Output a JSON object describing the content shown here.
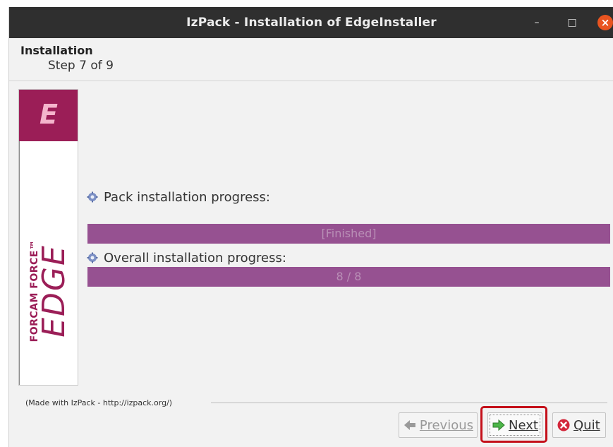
{
  "window": {
    "title": "IzPack - Installation of  EdgeInstaller",
    "controls": {
      "minimize": "–",
      "maximize": "□",
      "close": "×"
    }
  },
  "header": {
    "title": "Installation",
    "step": "Step 7 of 9"
  },
  "sidebar": {
    "logo_letter": "E",
    "brand_small": "FORCAM FORCE™",
    "brand_large": "EDGE"
  },
  "progress": {
    "pack": {
      "label": "Pack installation progress:",
      "text": "[Finished]",
      "fraction": 1.0
    },
    "overall": {
      "label": "Overall installation progress:",
      "text": "8 / 8",
      "fraction": 1.0
    }
  },
  "footer": {
    "made_with": "(Made with IzPack - http://izpack.org/)"
  },
  "buttons": {
    "previous": {
      "label": "Previous",
      "icon": "arrow-left-icon",
      "enabled": false
    },
    "next": {
      "label": "Next",
      "icon": "arrow-right-icon",
      "enabled": true
    },
    "quit": {
      "label": "Quit",
      "icon": "quit-icon",
      "enabled": true
    }
  },
  "colors": {
    "accent": "#965191",
    "brand": "#9b1e57",
    "close_button": "#e95420",
    "highlight": "#c4101a"
  }
}
